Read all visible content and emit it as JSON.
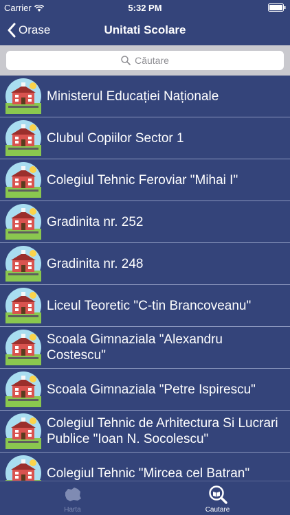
{
  "status_bar": {
    "carrier": "Carrier",
    "time": "5:32 PM"
  },
  "nav": {
    "back_label": "Orase",
    "title": "Unitati Scolare"
  },
  "search": {
    "placeholder": "Căutare"
  },
  "items": [
    {
      "label": "Ministerul Educației Naționale"
    },
    {
      "label": "Clubul Copiilor Sector 1"
    },
    {
      "label": "Colegiul Tehnic Feroviar \"Mihai I\""
    },
    {
      "label": "Gradinita nr. 252"
    },
    {
      "label": "Gradinita nr. 248"
    },
    {
      "label": "Liceul Teoretic \"C-tin Brancoveanu\""
    },
    {
      "label": "Scoala Gimnaziala \"Alexandru Costescu\""
    },
    {
      "label": "Scoala Gimnaziala \"Petre Ispirescu\""
    },
    {
      "label": "Colegiul Tehnic de Arhitectura Si Lucrari Publice \"Ioan N. Socolescu\""
    },
    {
      "label": "Colegiul Tehnic \"Mircea cel Batran\""
    }
  ],
  "tabs": [
    {
      "label": "Harta",
      "icon": "romania-map-icon",
      "selected": false
    },
    {
      "label": "Cautare",
      "icon": "search-book-icon",
      "selected": true
    }
  ],
  "colors": {
    "background": "#34447a",
    "separator": "#8a96bd",
    "tab_active": "#ffffff",
    "tab_inactive": "#7f8bb3"
  }
}
